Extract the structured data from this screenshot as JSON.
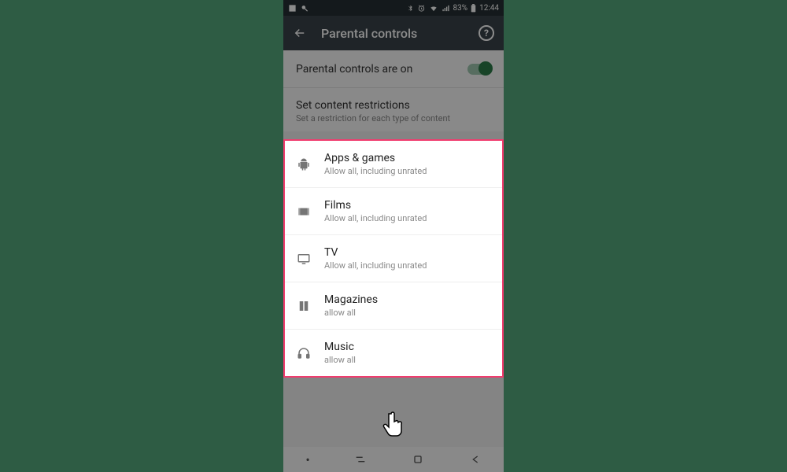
{
  "status": {
    "battery": "83%",
    "time": "12:44"
  },
  "appbar": {
    "title": "Parental controls"
  },
  "toggle": {
    "label": "Parental controls are on"
  },
  "section": {
    "title": "Set content restrictions",
    "sub": "Set a restriction for each type of content"
  },
  "items": [
    {
      "title": "Apps & games",
      "sub": "Allow all, including unrated",
      "icon": "android"
    },
    {
      "title": "Films",
      "sub": "Allow all, including unrated",
      "icon": "film"
    },
    {
      "title": "TV",
      "sub": "Allow all, including unrated",
      "icon": "tv"
    },
    {
      "title": "Magazines",
      "sub": "allow all",
      "icon": "magazine"
    },
    {
      "title": "Music",
      "sub": "allow all",
      "icon": "headphones"
    }
  ]
}
